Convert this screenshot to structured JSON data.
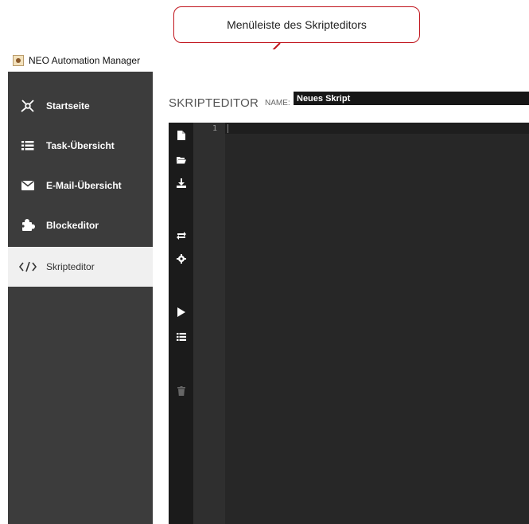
{
  "callout": {
    "text": "Menüleiste des Skripteditors"
  },
  "window": {
    "title": "NEO Automation Manager"
  },
  "sidebar": {
    "items": [
      {
        "label": "Startseite",
        "icon": "network-icon"
      },
      {
        "label": "Task-Übersicht",
        "icon": "list-icon"
      },
      {
        "label": "E-Mail-Übersicht",
        "icon": "envelope-icon"
      },
      {
        "label": "Blockeditor",
        "icon": "puzzle-icon"
      },
      {
        "label": "Skripteditor",
        "icon": "code-icon",
        "active": true
      }
    ]
  },
  "editor": {
    "title": "SKRIPTEDITOR",
    "name_label": "NAME:",
    "name_value": "Neues Skript",
    "line_numbers": [
      "1"
    ],
    "toolbar": [
      "new-file-icon",
      "open-folder-icon",
      "download-icon",
      "refresh-icon",
      "settings-icon",
      "run-icon",
      "list-icon",
      "delete-icon"
    ]
  },
  "colors": {
    "sidebar_bg": "#3c3c3c",
    "editor_bg": "#272727",
    "toolbar_bg": "#1b1b1b",
    "callout_border": "#c0141c"
  }
}
